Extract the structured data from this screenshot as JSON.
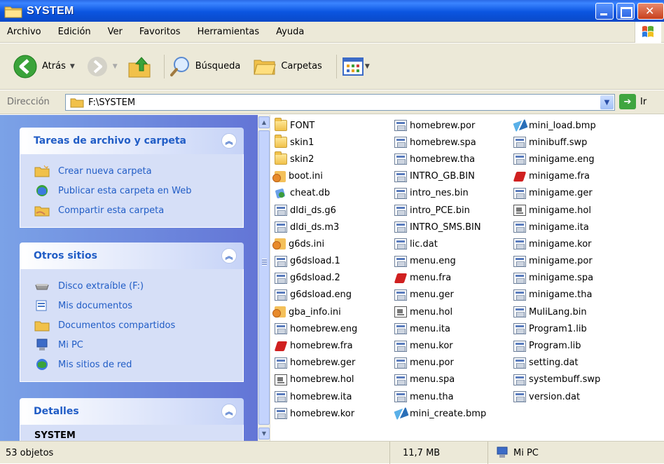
{
  "window": {
    "title": "SYSTEM"
  },
  "menu": [
    "Archivo",
    "Edición",
    "Ver",
    "Favoritos",
    "Herramientas",
    "Ayuda"
  ],
  "toolbar": {
    "back": "Atrás",
    "search": "Búsqueda",
    "folders": "Carpetas"
  },
  "address": {
    "label": "Dirección",
    "value": "F:\\SYSTEM",
    "go": "Ir"
  },
  "left_panels": {
    "tasks": {
      "title": "Tareas de archivo y carpeta",
      "items": [
        "Crear nueva carpeta",
        "Publicar esta carpeta en Web",
        "Compartir esta carpeta"
      ]
    },
    "places": {
      "title": "Otros sitios",
      "items": [
        "Disco extraíble (F:)",
        "Mis documentos",
        "Documentos compartidos",
        "Mi PC",
        "Mis sitios de red"
      ]
    },
    "details": {
      "title": "Detalles",
      "name": "SYSTEM"
    }
  },
  "files": {
    "col1": [
      {
        "name": "FONT",
        "icon": "folder-icon"
      },
      {
        "name": "skin1",
        "icon": "folder-icon"
      },
      {
        "name": "skin2",
        "icon": "folder-icon"
      },
      {
        "name": "boot.ini",
        "icon": "ini-icon"
      },
      {
        "name": "cheat.db",
        "icon": "db-icon"
      },
      {
        "name": "dldi_ds.g6",
        "icon": "file-icon"
      },
      {
        "name": "dldi_ds.m3",
        "icon": "file-icon"
      },
      {
        "name": "g6ds.ini",
        "icon": "ini-icon"
      },
      {
        "name": "g6dsload.1",
        "icon": "file-icon"
      },
      {
        "name": "g6dsload.2",
        "icon": "file-icon"
      },
      {
        "name": "g6dsload.eng",
        "icon": "file-icon"
      },
      {
        "name": "gba_info.ini",
        "icon": "ini-icon"
      },
      {
        "name": "homebrew.eng",
        "icon": "file-icon"
      },
      {
        "name": "homebrew.fra",
        "icon": "fra-icon"
      },
      {
        "name": "homebrew.ger",
        "icon": "file-icon"
      },
      {
        "name": "homebrew.hol",
        "icon": "hol-icon"
      },
      {
        "name": "homebrew.ita",
        "icon": "file-icon"
      },
      {
        "name": "homebrew.kor",
        "icon": "file-icon"
      }
    ],
    "col2": [
      {
        "name": "homebrew.por",
        "icon": "file-icon"
      },
      {
        "name": "homebrew.spa",
        "icon": "file-icon"
      },
      {
        "name": "homebrew.tha",
        "icon": "file-icon"
      },
      {
        "name": "INTRO_GB.BIN",
        "icon": "file-icon"
      },
      {
        "name": "intro_nes.bin",
        "icon": "file-icon"
      },
      {
        "name": "intro_PCE.bin",
        "icon": "file-icon"
      },
      {
        "name": "INTRO_SMS.BIN",
        "icon": "file-icon"
      },
      {
        "name": "lic.dat",
        "icon": "file-icon"
      },
      {
        "name": "menu.eng",
        "icon": "file-icon"
      },
      {
        "name": "menu.fra",
        "icon": "fra-icon"
      },
      {
        "name": "menu.ger",
        "icon": "file-icon"
      },
      {
        "name": "menu.hol",
        "icon": "hol-icon"
      },
      {
        "name": "menu.ita",
        "icon": "file-icon"
      },
      {
        "name": "menu.kor",
        "icon": "file-icon"
      },
      {
        "name": "menu.por",
        "icon": "file-icon"
      },
      {
        "name": "menu.spa",
        "icon": "file-icon"
      },
      {
        "name": "menu.tha",
        "icon": "file-icon"
      },
      {
        "name": "mini_create.bmp",
        "icon": "bmp-icon"
      }
    ],
    "col3": [
      {
        "name": "mini_load.bmp",
        "icon": "bmp-icon"
      },
      {
        "name": "minibuff.swp",
        "icon": "file-icon"
      },
      {
        "name": "minigame.eng",
        "icon": "file-icon"
      },
      {
        "name": "minigame.fra",
        "icon": "fra-icon"
      },
      {
        "name": "minigame.ger",
        "icon": "file-icon"
      },
      {
        "name": "minigame.hol",
        "icon": "hol-icon"
      },
      {
        "name": "minigame.ita",
        "icon": "file-icon"
      },
      {
        "name": "minigame.kor",
        "icon": "file-icon"
      },
      {
        "name": "minigame.por",
        "icon": "file-icon"
      },
      {
        "name": "minigame.spa",
        "icon": "file-icon"
      },
      {
        "name": "minigame.tha",
        "icon": "file-icon"
      },
      {
        "name": "MuliLang.bin",
        "icon": "file-icon"
      },
      {
        "name": "Program1.lib",
        "icon": "file-icon"
      },
      {
        "name": "Program.lib",
        "icon": "file-icon"
      },
      {
        "name": "setting.dat",
        "icon": "file-icon"
      },
      {
        "name": "systembuff.swp",
        "icon": "file-icon"
      },
      {
        "name": "version.dat",
        "icon": "file-icon"
      }
    ]
  },
  "status": {
    "count": "53 objetos",
    "size": "11,7 MB",
    "location": "Mi PC"
  }
}
